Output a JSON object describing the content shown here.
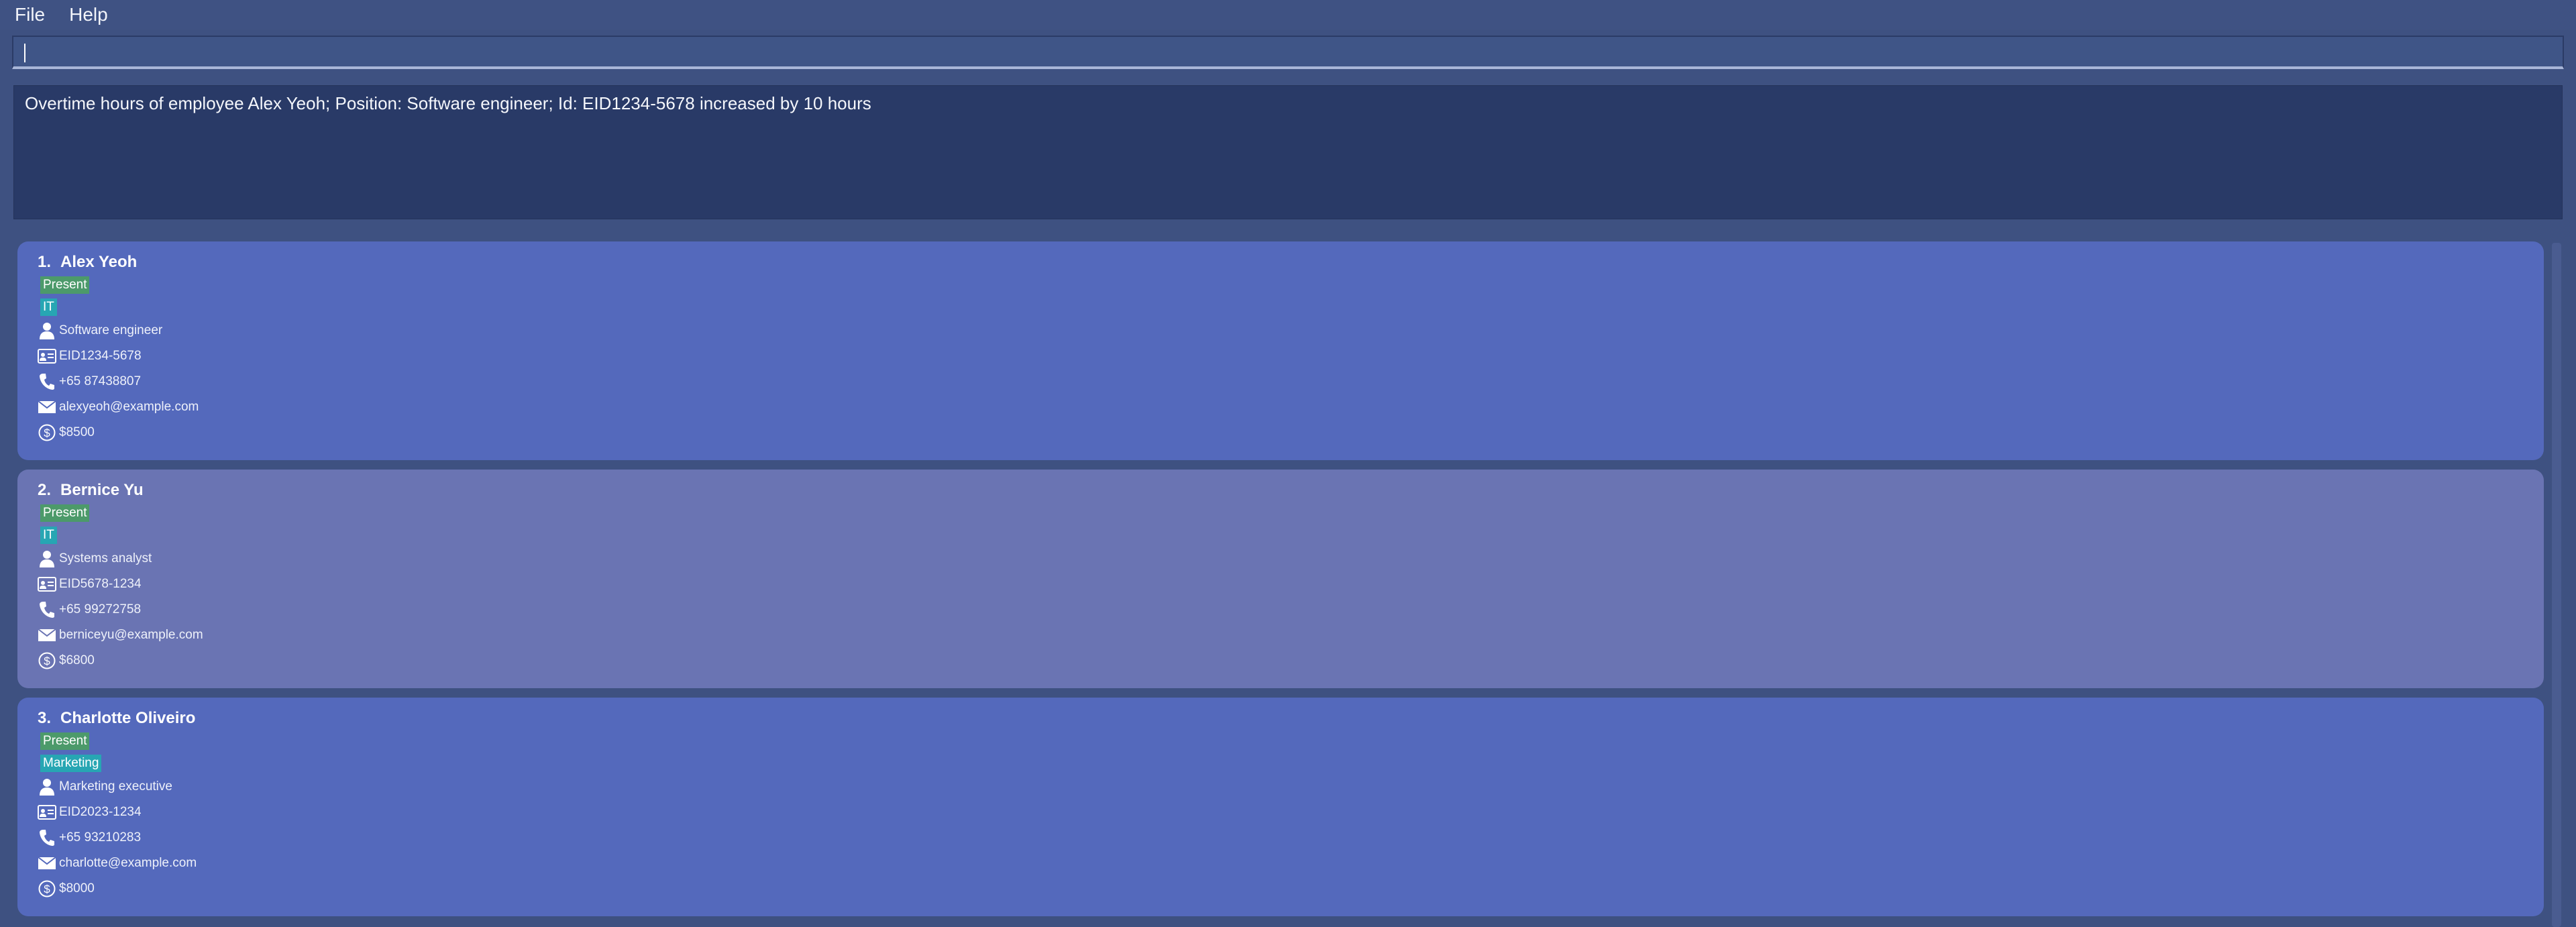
{
  "menu": {
    "file": "File",
    "help": "Help"
  },
  "command": {
    "value": "",
    "placeholder": ""
  },
  "result": {
    "message": "Overtime hours of employee Alex Yeoh; Position: Software engineer; Id: EID1234-5678 increased by 10 hours"
  },
  "employees": [
    {
      "index": "1.",
      "name": "Alex Yeoh",
      "status": "Present",
      "department": "IT",
      "position": "Software engineer",
      "id": "EID1234-5678",
      "phone": "+65 87438807",
      "email": "alexyeoh@example.com",
      "salary": "$8500"
    },
    {
      "index": "2.",
      "name": "Bernice Yu",
      "status": "Present",
      "department": "IT",
      "position": "Systems analyst",
      "id": "EID5678-1234",
      "phone": "+65 99272758",
      "email": "berniceyu@example.com",
      "salary": "$6800"
    },
    {
      "index": "3.",
      "name": "Charlotte Oliveiro",
      "status": "Present",
      "department": "Marketing",
      "position": "Marketing executive",
      "id": "EID2023-1234",
      "phone": "+65 93210283",
      "email": "charlotte@example.com",
      "salary": "$8000"
    }
  ],
  "icons": {
    "position": "person-icon",
    "id": "id-card-icon",
    "phone": "phone-icon",
    "email": "envelope-icon",
    "salary": "dollar-icon"
  },
  "colors": {
    "background": "#3e5181",
    "result_bg": "#293a67",
    "card": "#5469bc",
    "card_selected": "#6a74b3",
    "status_badge": "#4c9a6a",
    "dept_badge": "#27a6b3"
  }
}
